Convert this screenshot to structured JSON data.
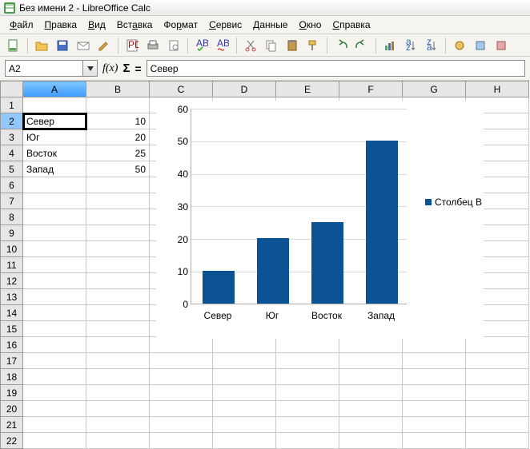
{
  "window": {
    "title": "Без имени 2 - LibreOffice Calc"
  },
  "menu": {
    "file": "Файл",
    "edit": "Правка",
    "view": "Вид",
    "insert": "Вставка",
    "format": "Формат",
    "service": "Сервис",
    "data": "Данные",
    "window": "Окно",
    "help": "Справка"
  },
  "refbar": {
    "cell": "A2",
    "formula": "Север",
    "fx": "f(x)",
    "sigma": "Σ",
    "eq": "="
  },
  "columns": [
    "A",
    "B",
    "C",
    "D",
    "E",
    "F",
    "G",
    "H"
  ],
  "rows": [
    "1",
    "2",
    "3",
    "4",
    "5",
    "6",
    "7",
    "8",
    "9",
    "10",
    "11",
    "12",
    "13",
    "14",
    "15",
    "16",
    "17",
    "18",
    "19",
    "20",
    "21",
    "22"
  ],
  "cells": {
    "A2": "Север",
    "B2": "10",
    "A3": "Юг",
    "B3": "20",
    "A4": "Восток",
    "B4": "25",
    "A5": "Запад",
    "B5": "50"
  },
  "chart_data": {
    "type": "bar",
    "categories": [
      "Север",
      "Юг",
      "Восток",
      "Запад"
    ],
    "series": [
      {
        "name": "Столбец B",
        "values": [
          10,
          20,
          25,
          50
        ]
      }
    ],
    "ylim": [
      0,
      60
    ],
    "yticks": [
      0,
      10,
      20,
      30,
      40,
      50,
      60
    ],
    "xlabel": "",
    "ylabel": "",
    "title": ""
  },
  "icons": {
    "new": "new-doc",
    "open": "open",
    "save": "save",
    "mail": "mail",
    "edit": "edit",
    "pdf": "pdf",
    "print": "print",
    "preview": "preview",
    "spell1": "abc-check",
    "spell2": "abc-underline",
    "cut": "cut",
    "copy": "copy",
    "paste": "paste",
    "brush": "brush",
    "undo": "undo",
    "redo": "redo",
    "chart": "chart",
    "sortA": "sort-asc",
    "sortD": "sort-desc",
    "misc1": "tool1",
    "misc2": "tool2",
    "misc3": "tool3"
  }
}
